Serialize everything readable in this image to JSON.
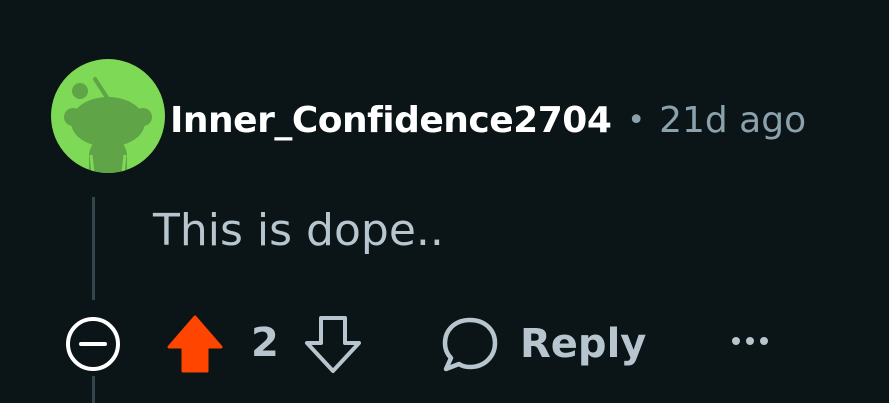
{
  "comment": {
    "author": "Inner_Confidence2704",
    "separator": "•",
    "age": "21d ago",
    "body": "This is dope..",
    "avatar_color": "#7ed957",
    "avatar_icon": "snoo-avatar-icon"
  },
  "actions": {
    "collapse_icon": "collapse-icon",
    "upvote_icon": "upvote-arrow-icon",
    "upvote_active_color": "#ff4500",
    "vote_count": "2",
    "downvote_icon": "downvote-arrow-icon",
    "reply_icon": "comment-bubble-icon",
    "reply_label": "Reply",
    "more_icon": "more-options-icon"
  },
  "colors": {
    "background": "#0b1416",
    "text_primary": "#ffffff",
    "text_secondary": "#8ba2ad",
    "text_body": "#b7c5ce"
  }
}
